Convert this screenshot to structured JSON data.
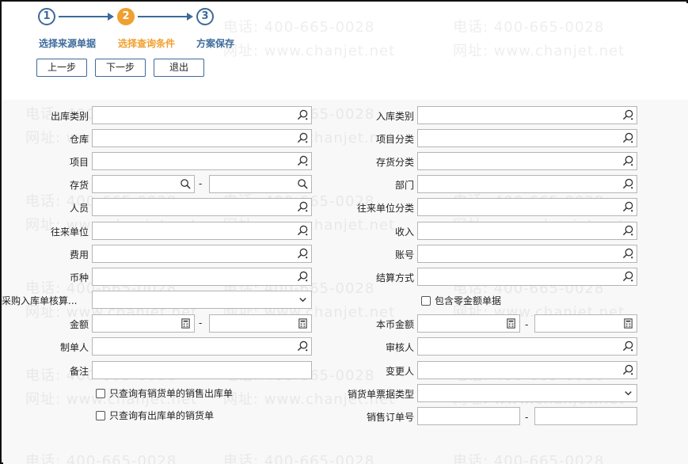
{
  "wizard": {
    "steps": [
      {
        "num": "1",
        "label": "选择来源单据"
      },
      {
        "num": "2",
        "label": "选择查询条件"
      },
      {
        "num": "3",
        "label": "方案保存"
      }
    ]
  },
  "buttons": {
    "prev": "上一步",
    "next": "下一步",
    "exit": "退出"
  },
  "watermark": {
    "phone": "电话: 400-665-0028",
    "site": "网址: www.chanjet.net"
  },
  "form": {
    "outbound_type": "出库类别",
    "inbound_type": "入库类别",
    "warehouse": "仓库",
    "project_category": "项目分类",
    "project": "项目",
    "inventory_category": "存货分类",
    "inventory": "存货",
    "department": "部门",
    "person": "人员",
    "partner_category": "往来单位分类",
    "partner": "往来单位",
    "income": "收入",
    "expense": "费用",
    "account": "账号",
    "currency": "币种",
    "settlement_method": "结算方式",
    "purchase_inbound": "采购入库单核算...",
    "include_zero": "包含零金额单据",
    "amount": "金额",
    "local_amount": "本币金额",
    "creator": "制单人",
    "reviewer": "审核人",
    "remark": "备注",
    "modifier": "变更人",
    "only_sales_invoice": "只查询有销货单的销售出库单",
    "invoice_type": "销货单票据类型",
    "only_outbound": "只查询有出库单的销货单",
    "sales_order_no": "销售订单号",
    "dash": "-"
  }
}
